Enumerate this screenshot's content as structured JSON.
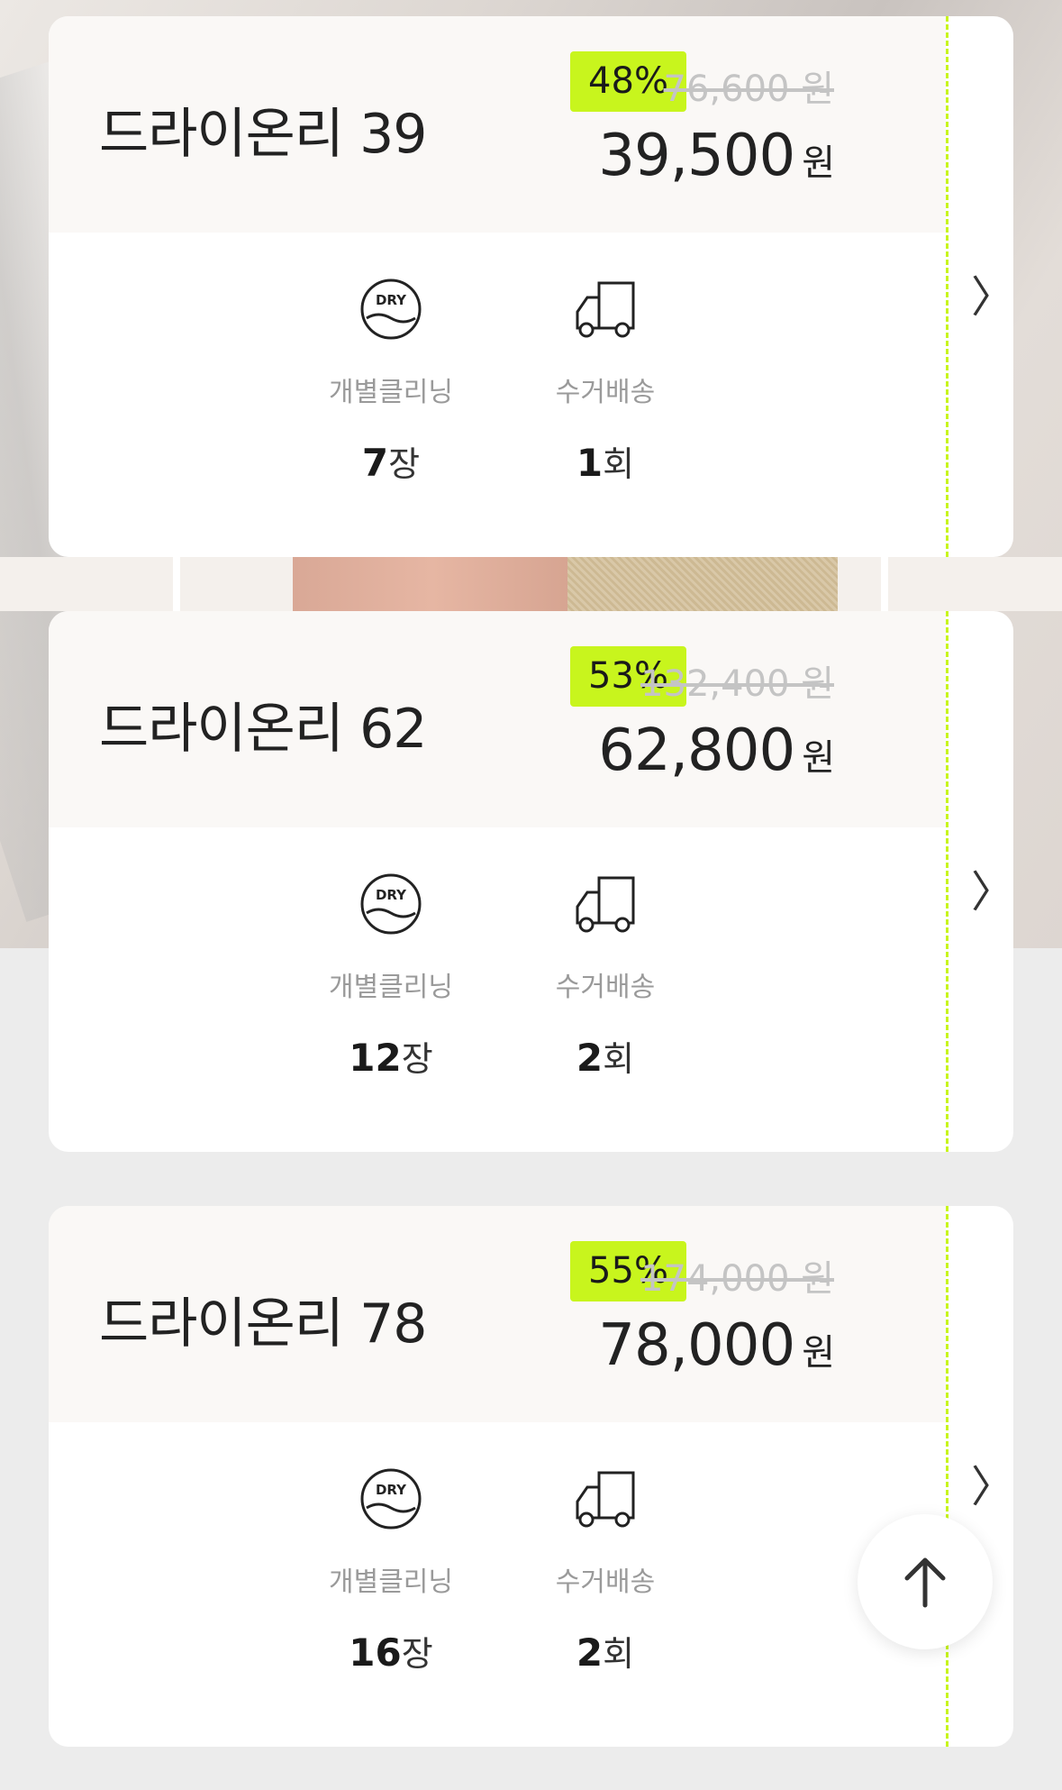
{
  "plans": [
    {
      "name": "드라이온리 39",
      "discount": "48%",
      "original_price": "76,600 원",
      "price": "39,500",
      "currency": "원",
      "features": [
        {
          "icon": "dry-cleaning-icon",
          "label": "개별클리닝",
          "count": "7",
          "unit": "장"
        },
        {
          "icon": "delivery-truck-icon",
          "label": "수거배송",
          "count": "1",
          "unit": "회"
        }
      ]
    },
    {
      "name": "드라이온리 62",
      "discount": "53%",
      "original_price": "132,400 원",
      "price": "62,800",
      "currency": "원",
      "features": [
        {
          "icon": "dry-cleaning-icon",
          "label": "개별클리닝",
          "count": "12",
          "unit": "장"
        },
        {
          "icon": "delivery-truck-icon",
          "label": "수거배송",
          "count": "2",
          "unit": "회"
        }
      ]
    },
    {
      "name": "드라이온리 78",
      "discount": "55%",
      "original_price": "174,000 원",
      "price": "78,000",
      "currency": "원",
      "features": [
        {
          "icon": "dry-cleaning-icon",
          "label": "개별클리닝",
          "count": "16",
          "unit": "장"
        },
        {
          "icon": "delivery-truck-icon",
          "label": "수거배송",
          "count": "2",
          "unit": "회"
        }
      ]
    }
  ],
  "icons": {
    "dry_label": "DRY",
    "chevron": "〉",
    "scroll_top": "arrow-up-icon"
  },
  "colors": {
    "accent": "#c8f51d",
    "text": "#222222",
    "muted": "#9a9a9a",
    "strike": "#c4c4c4",
    "header_bg": "#faf8f6",
    "page_bg": "#ececec"
  }
}
